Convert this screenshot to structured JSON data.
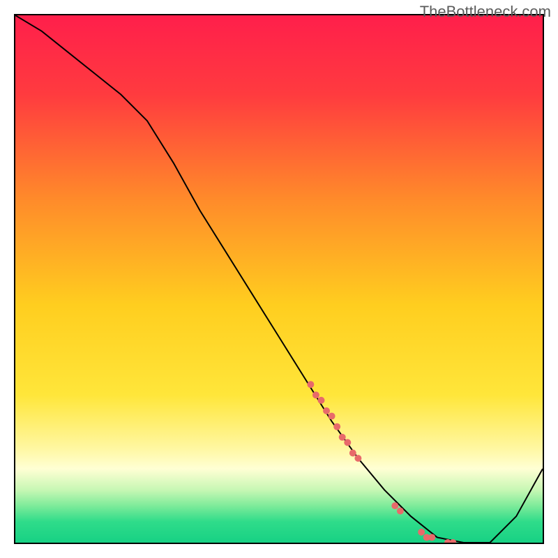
{
  "watermark": "TheBottleneck.com",
  "chart_data": {
    "type": "line",
    "title": "",
    "xlabel": "",
    "ylabel": "",
    "xlim": [
      0,
      100
    ],
    "ylim": [
      0,
      100
    ],
    "grid": false,
    "legend": false,
    "background": {
      "type": "vertical-gradient",
      "stops": [
        {
          "pct": 0,
          "color": "#ff1f4b"
        },
        {
          "pct": 15,
          "color": "#ff3b3f"
        },
        {
          "pct": 35,
          "color": "#ff8b2a"
        },
        {
          "pct": 55,
          "color": "#ffce1f"
        },
        {
          "pct": 72,
          "color": "#ffe63a"
        },
        {
          "pct": 82,
          "color": "#fff7a0"
        },
        {
          "pct": 86,
          "color": "#ffffd4"
        },
        {
          "pct": 90,
          "color": "#c7f7b4"
        },
        {
          "pct": 93,
          "color": "#7eeb9a"
        },
        {
          "pct": 96,
          "color": "#2fdc8a"
        },
        {
          "pct": 100,
          "color": "#17d184"
        }
      ]
    },
    "series": [
      {
        "name": "bottleneck-curve",
        "color": "#000000",
        "stroke_width": 2,
        "x": [
          0,
          5,
          10,
          15,
          20,
          25,
          30,
          35,
          40,
          45,
          50,
          55,
          60,
          65,
          70,
          75,
          80,
          85,
          90,
          95,
          100
        ],
        "y": [
          100,
          97,
          93,
          89,
          85,
          80,
          72,
          63,
          55,
          47,
          39,
          31,
          23,
          16,
          10,
          5,
          1,
          0,
          0,
          5,
          14
        ]
      }
    ],
    "markers": {
      "name": "highlight-points",
      "color": "#e86a6a",
      "radius": 5,
      "points": [
        {
          "x": 56,
          "y": 30
        },
        {
          "x": 57,
          "y": 28
        },
        {
          "x": 58,
          "y": 27
        },
        {
          "x": 59,
          "y": 25
        },
        {
          "x": 60,
          "y": 24
        },
        {
          "x": 61,
          "y": 22
        },
        {
          "x": 62,
          "y": 20
        },
        {
          "x": 63,
          "y": 19
        },
        {
          "x": 64,
          "y": 17
        },
        {
          "x": 65,
          "y": 16
        },
        {
          "x": 72,
          "y": 7
        },
        {
          "x": 73,
          "y": 6
        },
        {
          "x": 77,
          "y": 2
        },
        {
          "x": 78,
          "y": 1
        },
        {
          "x": 79,
          "y": 1
        },
        {
          "x": 82,
          "y": 0
        },
        {
          "x": 83,
          "y": 0
        }
      ]
    }
  }
}
